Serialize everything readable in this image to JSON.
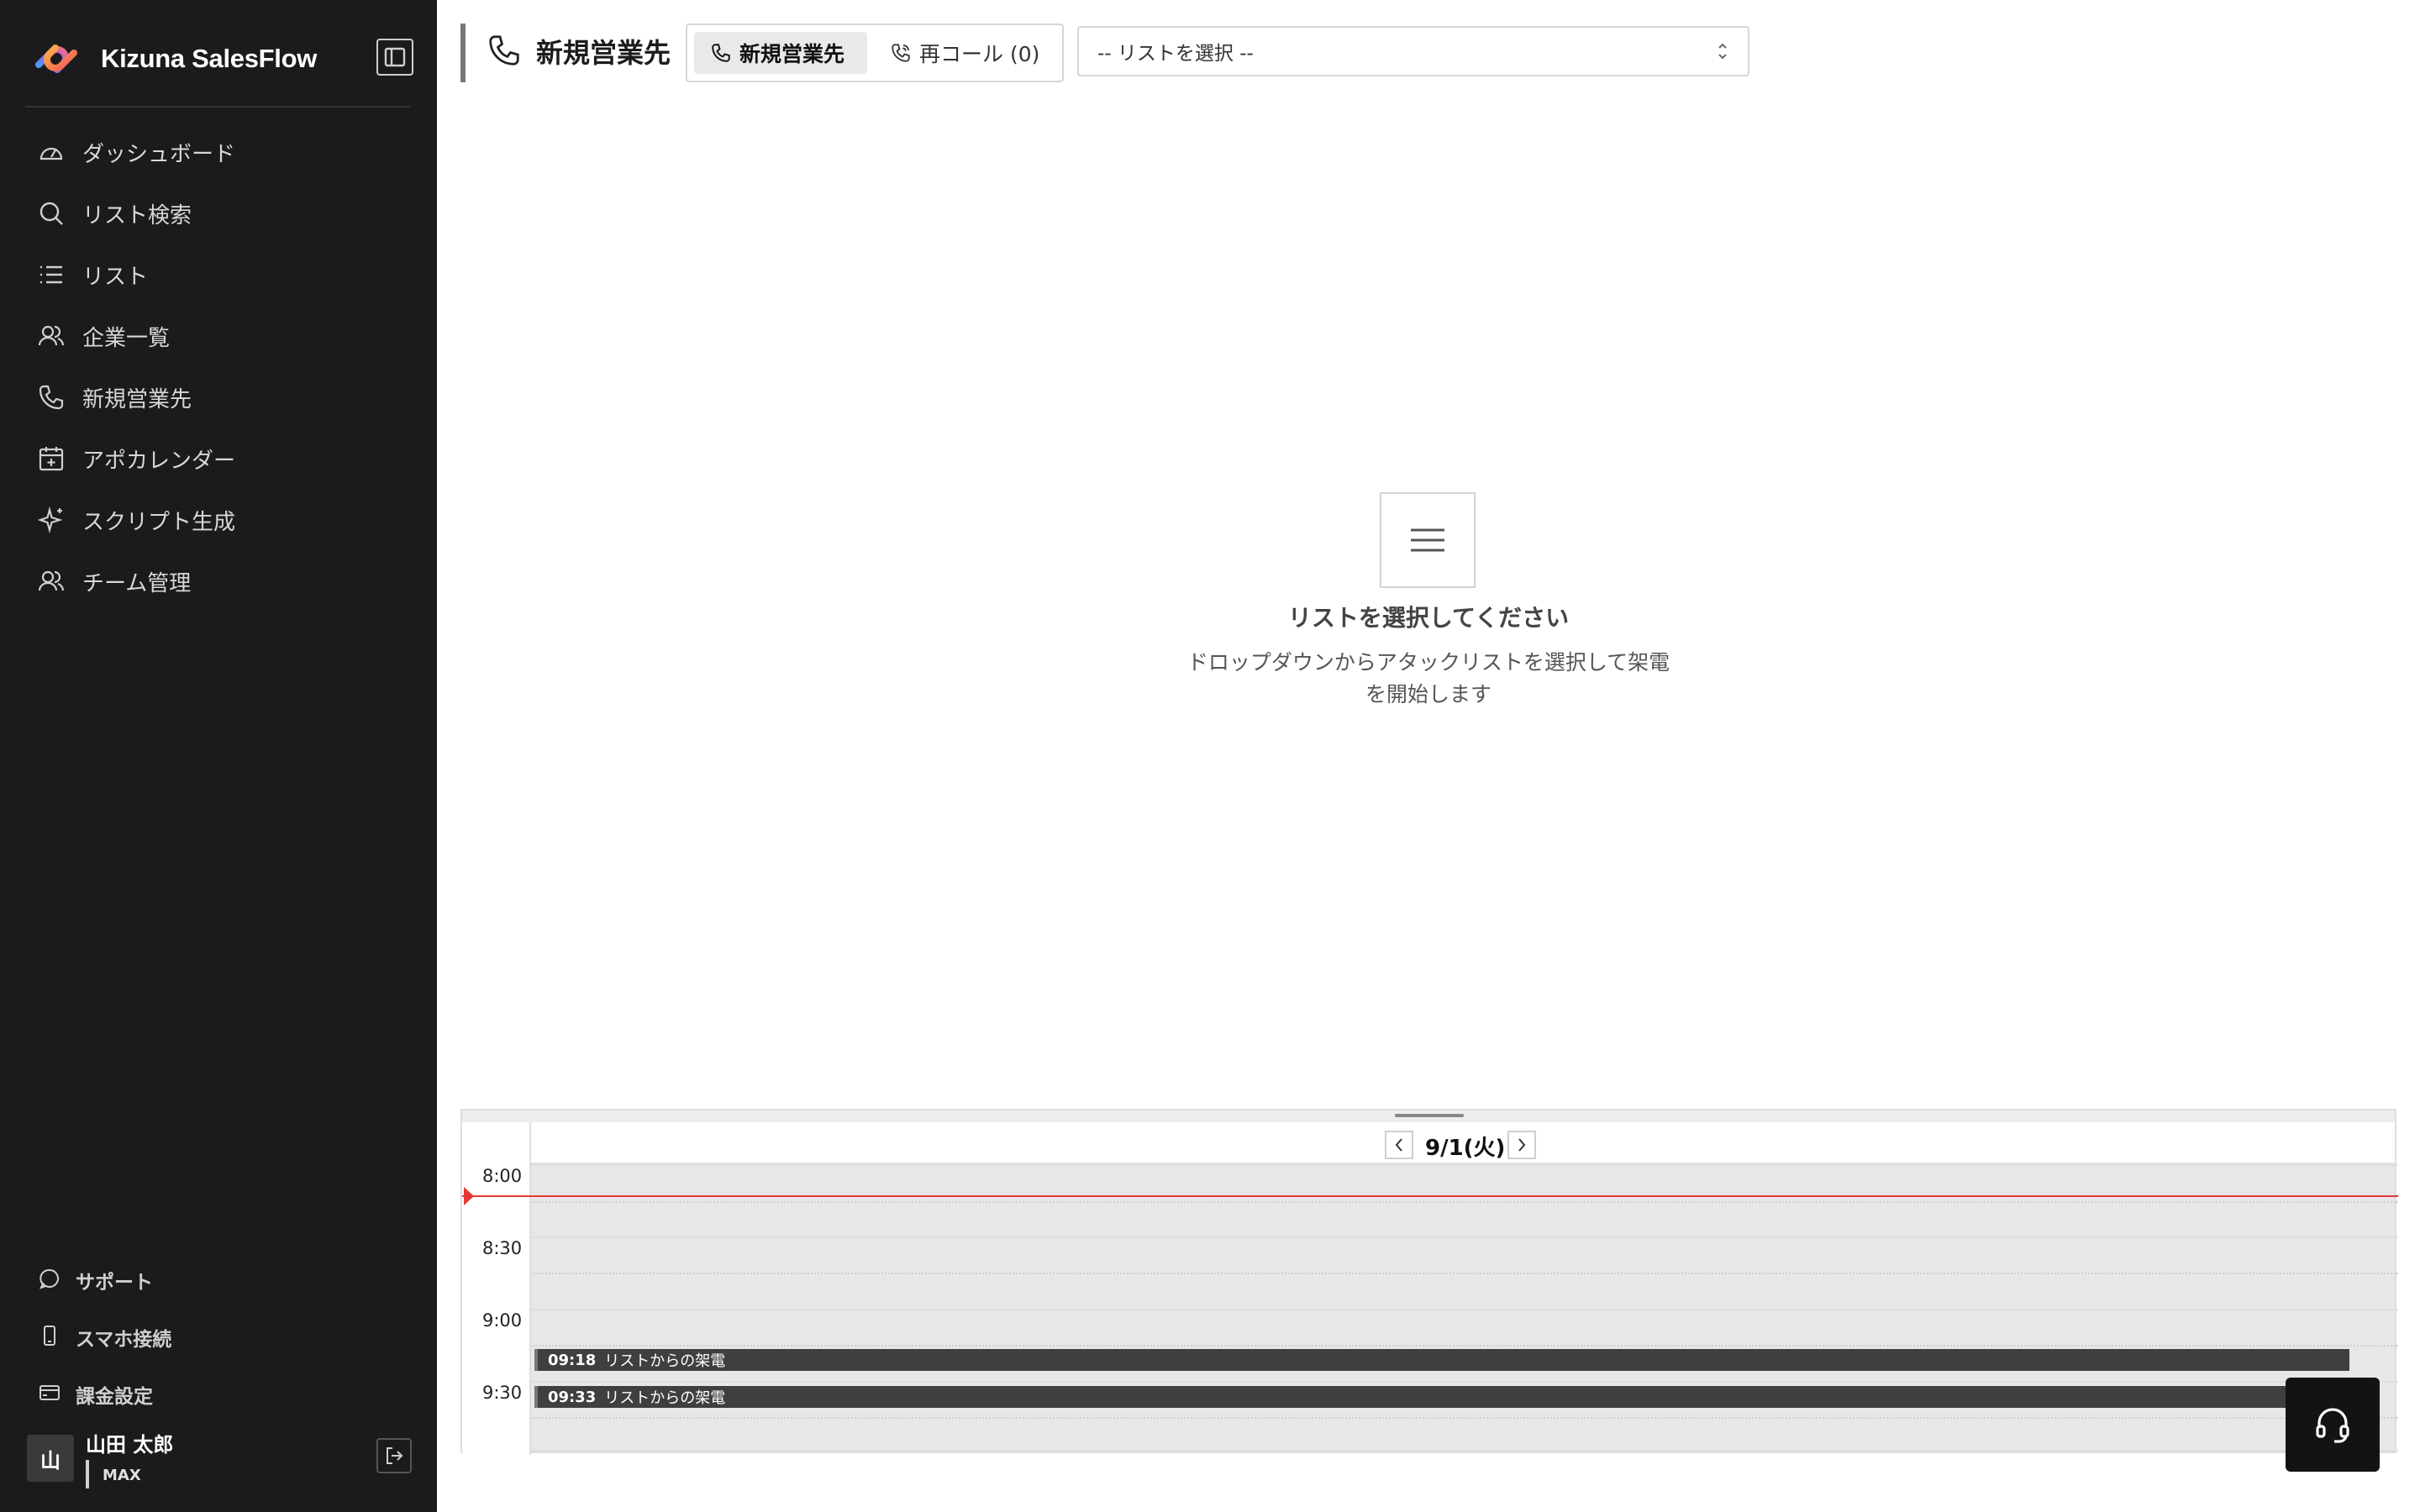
{
  "app": {
    "name": "Kizuna SalesFlow"
  },
  "sidebar": {
    "items": [
      {
        "label": "ダッシュボード",
        "icon": "gauge-icon"
      },
      {
        "label": "リスト検索",
        "icon": "search-icon"
      },
      {
        "label": "リスト",
        "icon": "list-icon"
      },
      {
        "label": "企業一覧",
        "icon": "users-icon"
      },
      {
        "label": "新規営業先",
        "icon": "phone-icon"
      },
      {
        "label": "アポカレンダー",
        "icon": "calendar-plus-icon"
      },
      {
        "label": "スクリプト生成",
        "icon": "sparkle-icon"
      },
      {
        "label": "チーム管理",
        "icon": "team-icon"
      }
    ],
    "bottom_items": [
      {
        "label": "サポート",
        "icon": "chat-icon"
      },
      {
        "label": "スマホ接続",
        "icon": "smartphone-icon"
      },
      {
        "label": "課金設定",
        "icon": "credit-card-icon"
      }
    ],
    "user": {
      "avatar_initial": "山",
      "name": "山田 太郎",
      "plan": "MAX"
    }
  },
  "header": {
    "title": "新規営業先",
    "tabs": [
      {
        "label": "新規営業先",
        "active": true
      },
      {
        "label": "再コール (0)",
        "active": false
      }
    ],
    "select": {
      "value": "-- リストを選択 --"
    }
  },
  "empty_state": {
    "title": "リストを選択してください",
    "description_line1": "ドロップダウンからアタックリストを選択して架電",
    "description_line2": "を開始します"
  },
  "calendar": {
    "date": "9/1(火)",
    "times": [
      "8:00",
      "8:30",
      "9:00",
      "9:30"
    ],
    "events": [
      {
        "time": "09:18",
        "title": "リストからの架電"
      },
      {
        "time": "09:33",
        "title": "リストからの架電"
      }
    ]
  },
  "colors": {
    "sidebar_bg": "#1b1b1d",
    "now_indicator": "#e53935",
    "event_bg": "#3f3f42"
  }
}
